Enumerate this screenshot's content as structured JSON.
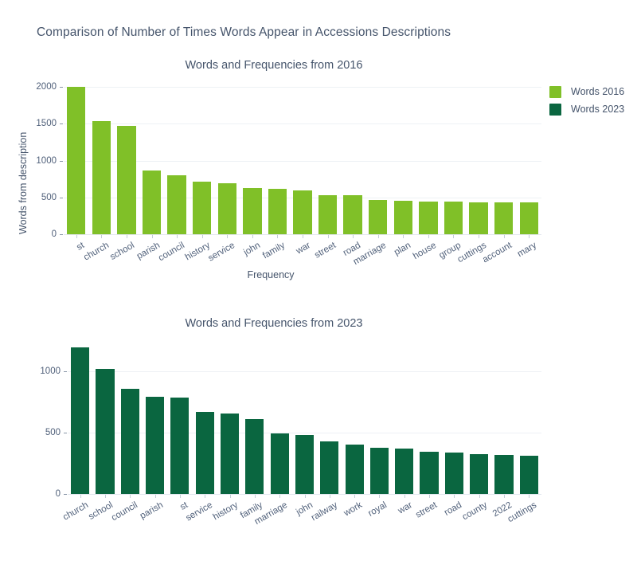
{
  "figure": {
    "title": "Comparison of Number of Times Words Appear in Accessions Descriptions",
    "background": "#ffffff"
  },
  "legend": {
    "position": "top-right",
    "items": [
      {
        "label": "Words 2016",
        "color": "#80C028"
      },
      {
        "label": "Words 2023",
        "color": "#0A6640"
      }
    ]
  },
  "chart_data": [
    {
      "type": "bar",
      "title": "Words and Frequencies from 2016",
      "xlabel": "Frequency",
      "ylabel": "Words from description",
      "series_name": "Words 2016",
      "color": "#80C028",
      "ylim": [
        0,
        2000
      ],
      "yticks": [
        0,
        500,
        1000,
        1500,
        2000
      ],
      "grid": true,
      "categories": [
        "st",
        "church",
        "school",
        "parish",
        "council",
        "history",
        "service",
        "john",
        "family",
        "war",
        "street",
        "road",
        "marriage",
        "plan",
        "house",
        "group",
        "cuttings",
        "account",
        "mary"
      ],
      "values": [
        2000,
        1540,
        1470,
        865,
        800,
        715,
        695,
        630,
        620,
        600,
        535,
        525,
        460,
        450,
        445,
        440,
        435,
        432,
        428
      ]
    },
    {
      "type": "bar",
      "title": "Words and Frequencies from 2023",
      "xlabel": "",
      "ylabel": "",
      "series_name": "Words 2023",
      "color": "#0A6640",
      "ylim": [
        0,
        1250
      ],
      "yticks": [
        0,
        500,
        1000
      ],
      "grid": true,
      "categories": [
        "church",
        "school",
        "council",
        "parish",
        "st",
        "service",
        "history",
        "family",
        "marriage",
        "john",
        "railway",
        "work",
        "royal",
        "war",
        "street",
        "road",
        "county",
        "2022",
        "cuttings"
      ],
      "values": [
        1195,
        1025,
        860,
        795,
        790,
        670,
        660,
        610,
        495,
        480,
        430,
        405,
        375,
        372,
        345,
        340,
        325,
        320,
        312
      ]
    }
  ]
}
